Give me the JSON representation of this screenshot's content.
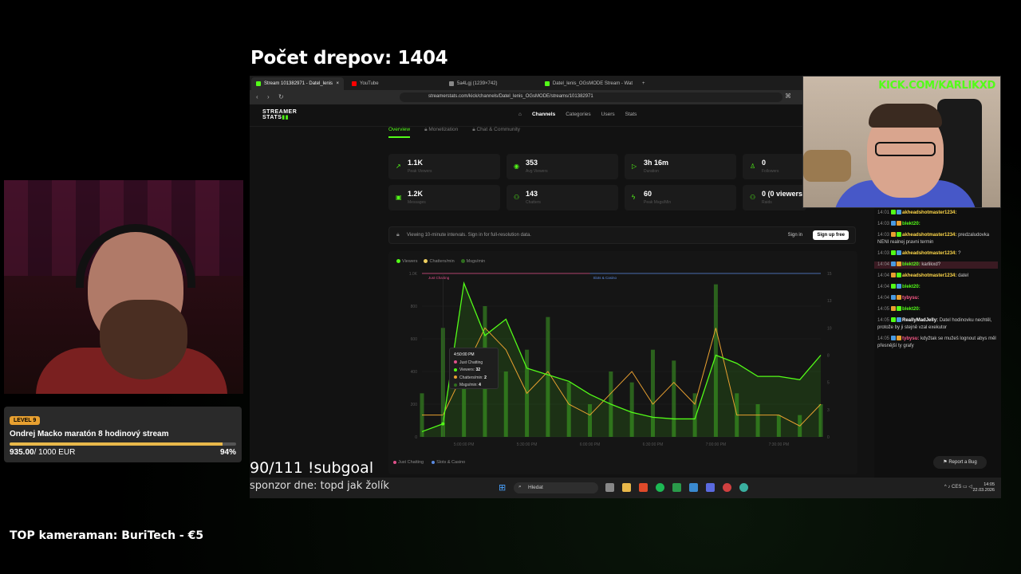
{
  "overlay": {
    "title": "Počet drepov: 1404",
    "subgoal": "90/111 !subgoal",
    "sponsor": "sponzor dne: topd jak žolík",
    "top_cameraman": "TOP kameraman: BuriTech - €5"
  },
  "goal": {
    "level": "LEVEL 9",
    "title": "Ondrej Macko maratón 8 hodinový stream",
    "current": "935.00",
    "target": "/ 1000 EUR",
    "percent": "94%",
    "progress_fraction": 0.94,
    "bar_color": "#e8b84a"
  },
  "browser": {
    "tabs": [
      {
        "label": "Stream 101382971 - Datel_lenis",
        "active": true,
        "icon": "kick-icon"
      },
      {
        "label": "YouTube",
        "active": false,
        "icon": "youtube-icon"
      },
      {
        "label": "5a4Lgj (1239×742)",
        "active": false,
        "icon": "image-icon"
      },
      {
        "label": "Datel_lenis_OGsMODE Stream - Wat",
        "active": false,
        "icon": "kick-icon"
      }
    ],
    "url": "streamerstats.com/kick/channels/Datel_lenis_OGsMODE/streams/101382971"
  },
  "site": {
    "logo_top": "STREAMER",
    "logo_bottom": "STATS",
    "nav": [
      {
        "label": "Channels",
        "active": true
      },
      {
        "label": "Categories",
        "active": false
      },
      {
        "label": "Users",
        "active": false
      },
      {
        "label": "Stats",
        "active": false
      }
    ],
    "subtabs": [
      {
        "label": "Overview",
        "active": true
      },
      {
        "label": "Monetization",
        "active": false
      },
      {
        "label": "Chat & Community",
        "active": false
      }
    ],
    "stats": [
      {
        "value": "1.1K",
        "label": "Peak Viewers",
        "icon": "trend-icon"
      },
      {
        "value": "353",
        "label": "Avg Viewers",
        "icon": "eye-icon"
      },
      {
        "value": "3h 16m",
        "label": "Duration",
        "icon": "play-icon"
      },
      {
        "value": "0",
        "label": "Followers",
        "icon": "user-plus-icon"
      },
      {
        "value": "1.2K",
        "label": "Messages",
        "icon": "chat-icon"
      },
      {
        "value": "143",
        "label": "Chatters",
        "icon": "users-icon"
      },
      {
        "value": "60",
        "label": "Peak Msgs/Min",
        "icon": "bolt-icon"
      },
      {
        "value": "0 (0 viewers)",
        "label": "Raids",
        "icon": "raid-icon"
      }
    ],
    "notice": "Viewing 10-minute intervals. Sign in for full-resolution data.",
    "sign_in": "Sign in",
    "sign_up": "Sign up free",
    "report_bug": "Report a Bug"
  },
  "chart_data": {
    "type": "line",
    "legend": [
      "Viewers",
      "Chatters/min",
      "Msgs/min"
    ],
    "x": [
      "4:40",
      "4:50",
      "5:00",
      "5:10",
      "5:20",
      "5:30",
      "5:40",
      "5:50",
      "6:00",
      "6:10",
      "6:20",
      "6:30",
      "6:40",
      "6:50",
      "7:00",
      "7:10",
      "7:20",
      "7:30",
      "7:40",
      "7:50"
    ],
    "x_tick_labels": [
      "5:00:00 PM",
      "5:30:00 PM",
      "6:00:00 PM",
      "6:30:00 PM",
      "7:00:00 PM",
      "7:30:00 PM"
    ],
    "y_left_ticks": [
      "0",
      "200",
      "400",
      "600",
      "800",
      "1.0K"
    ],
    "y_right_ticks": [
      "0",
      "3",
      "5",
      "8",
      "10",
      "13",
      "15"
    ],
    "ylim_left": [
      0,
      1000
    ],
    "ylim_right": [
      0,
      15
    ],
    "series": [
      {
        "name": "Viewers",
        "color": "#53fc18",
        "values": [
          32,
          80,
          940,
          620,
          720,
          420,
          380,
          340,
          260,
          200,
          150,
          120,
          110,
          110,
          500,
          450,
          370,
          370,
          350,
          500
        ]
      },
      {
        "name": "Chatters/min",
        "color": "#e8a030",
        "values": [
          2,
          2,
          6,
          10,
          8,
          4,
          6,
          3,
          2,
          4,
          6,
          3,
          5,
          3,
          10,
          2,
          2,
          2,
          1,
          3
        ]
      },
      {
        "name": "Msgs/min",
        "color": "#2f6e1e",
        "values": [
          4,
          10,
          8,
          12,
          6,
          8,
          11,
          5,
          3,
          6,
          5,
          8,
          7,
          4,
          14,
          4,
          3,
          2,
          2,
          3
        ]
      }
    ],
    "bands": [
      {
        "name": "Just Chatting",
        "color": "#e0508a"
      },
      {
        "name": "Slots & Casino",
        "color": "#5a8ae0"
      }
    ],
    "tooltip": {
      "time": "4:50:00 PM",
      "category": "Just Chatting",
      "viewers_label": "Viewers:",
      "viewers": "32",
      "chatters_label": "Chatters/min:",
      "chatters": "2",
      "msgs_label": "Msgs/min:",
      "msgs": "4"
    },
    "grid": true
  },
  "chat": {
    "messages": [
      {
        "time": "14:01",
        "user": "akheadshotmaster1234:",
        "cls": "u1",
        "text": ""
      },
      {
        "time": "14:03",
        "user": "blekt20:",
        "cls": "u2",
        "text": ""
      },
      {
        "time": "14:03",
        "user": "akheadshotmaster1234:",
        "cls": "u1",
        "text": "predzaludovka NENI realnej pravni termin"
      },
      {
        "time": "14:03",
        "user": "akheadshotmaster1234:",
        "cls": "u1",
        "text": "?"
      },
      {
        "time": "14:04",
        "user": "blekt20:",
        "cls": "u2",
        "text": "karlikxd?",
        "highlight": true
      },
      {
        "time": "14:04",
        "user": "akheadshotmaster1234:",
        "cls": "u1",
        "text": "datel"
      },
      {
        "time": "14:04",
        "user": "blekt20:",
        "cls": "u2",
        "text": ""
      },
      {
        "time": "14:04",
        "user": "tybysu:",
        "cls": "u3",
        "text": ""
      },
      {
        "time": "14:05",
        "user": "blekt20:",
        "cls": "u2",
        "text": ""
      },
      {
        "time": "14:05",
        "user": "ReallyMadJelly:",
        "cls": "u4",
        "text": "Datel hodinovku nechtěl, protože by ji stejně vzal exekutor"
      },
      {
        "time": "14:05",
        "user": "tybysu:",
        "cls": "u3",
        "text": "kdyžtak se mužeš lognout abys měl přesnější ty grafy"
      }
    ]
  },
  "taskbar": {
    "search": "Hledat",
    "lang": "CES",
    "time": "14:05",
    "date": "22.03.2026"
  },
  "webcam_right": {
    "overlay_text": "KICK.COM/KARLIKXD"
  },
  "colors": {
    "accent": "#53fc18",
    "background": "#121212",
    "card": "#1b1b1b"
  }
}
